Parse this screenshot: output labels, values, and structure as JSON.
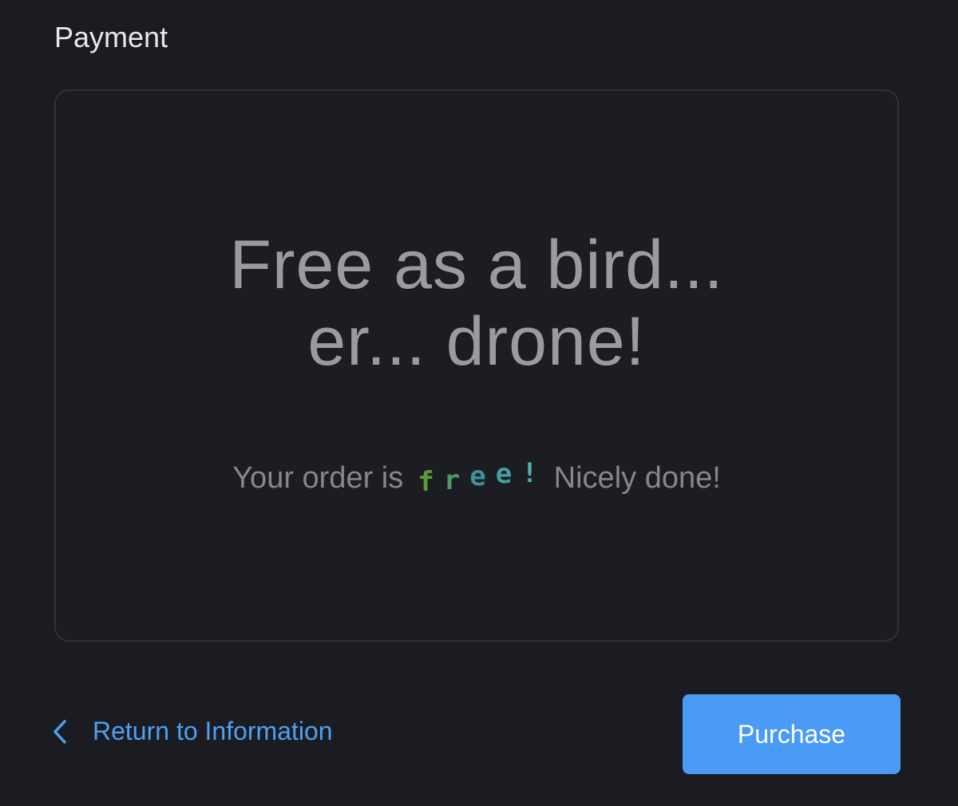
{
  "payment": {
    "title": "Payment",
    "headline_line1": "Free as a bird...",
    "headline_line2": "er... drone!",
    "message_prefix": "Your order is",
    "free_chars": [
      "f",
      "r",
      "e",
      "e",
      "!"
    ],
    "message_suffix": "Nicely done!"
  },
  "footer": {
    "return_label": "Return to Information",
    "purchase_label": "Purchase"
  },
  "colors": {
    "background": "#1b1c21",
    "link": "#4ea0f2",
    "button": "#499bf6"
  },
  "icons": {
    "return": "chevron-left-icon"
  }
}
